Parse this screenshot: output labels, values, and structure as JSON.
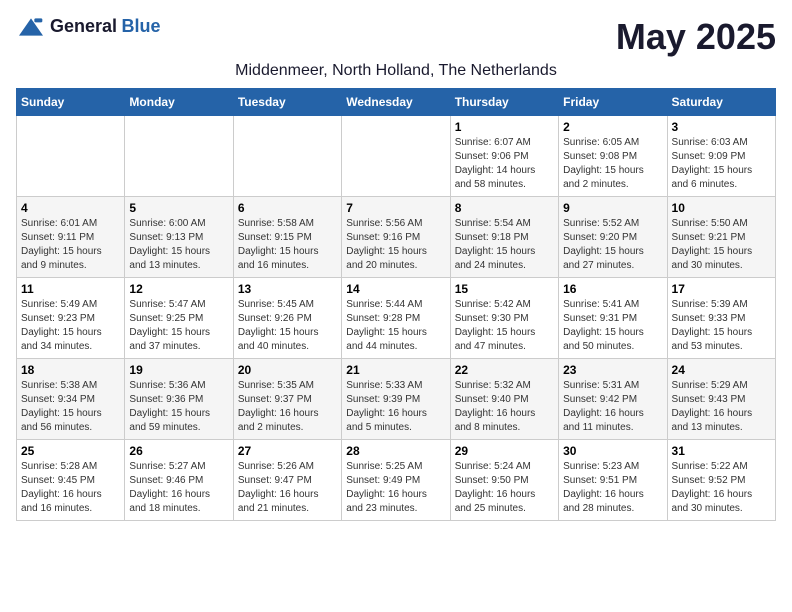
{
  "logo": {
    "general": "General",
    "blue": "Blue"
  },
  "title": "May 2025",
  "subtitle": "Middenmeer, North Holland, The Netherlands",
  "days_of_week": [
    "Sunday",
    "Monday",
    "Tuesday",
    "Wednesday",
    "Thursday",
    "Friday",
    "Saturday"
  ],
  "weeks": [
    [
      {
        "day": "",
        "detail": ""
      },
      {
        "day": "",
        "detail": ""
      },
      {
        "day": "",
        "detail": ""
      },
      {
        "day": "",
        "detail": ""
      },
      {
        "day": "1",
        "detail": "Sunrise: 6:07 AM\nSunset: 9:06 PM\nDaylight: 14 hours\nand 58 minutes."
      },
      {
        "day": "2",
        "detail": "Sunrise: 6:05 AM\nSunset: 9:08 PM\nDaylight: 15 hours\nand 2 minutes."
      },
      {
        "day": "3",
        "detail": "Sunrise: 6:03 AM\nSunset: 9:09 PM\nDaylight: 15 hours\nand 6 minutes."
      }
    ],
    [
      {
        "day": "4",
        "detail": "Sunrise: 6:01 AM\nSunset: 9:11 PM\nDaylight: 15 hours\nand 9 minutes."
      },
      {
        "day": "5",
        "detail": "Sunrise: 6:00 AM\nSunset: 9:13 PM\nDaylight: 15 hours\nand 13 minutes."
      },
      {
        "day": "6",
        "detail": "Sunrise: 5:58 AM\nSunset: 9:15 PM\nDaylight: 15 hours\nand 16 minutes."
      },
      {
        "day": "7",
        "detail": "Sunrise: 5:56 AM\nSunset: 9:16 PM\nDaylight: 15 hours\nand 20 minutes."
      },
      {
        "day": "8",
        "detail": "Sunrise: 5:54 AM\nSunset: 9:18 PM\nDaylight: 15 hours\nand 24 minutes."
      },
      {
        "day": "9",
        "detail": "Sunrise: 5:52 AM\nSunset: 9:20 PM\nDaylight: 15 hours\nand 27 minutes."
      },
      {
        "day": "10",
        "detail": "Sunrise: 5:50 AM\nSunset: 9:21 PM\nDaylight: 15 hours\nand 30 minutes."
      }
    ],
    [
      {
        "day": "11",
        "detail": "Sunrise: 5:49 AM\nSunset: 9:23 PM\nDaylight: 15 hours\nand 34 minutes."
      },
      {
        "day": "12",
        "detail": "Sunrise: 5:47 AM\nSunset: 9:25 PM\nDaylight: 15 hours\nand 37 minutes."
      },
      {
        "day": "13",
        "detail": "Sunrise: 5:45 AM\nSunset: 9:26 PM\nDaylight: 15 hours\nand 40 minutes."
      },
      {
        "day": "14",
        "detail": "Sunrise: 5:44 AM\nSunset: 9:28 PM\nDaylight: 15 hours\nand 44 minutes."
      },
      {
        "day": "15",
        "detail": "Sunrise: 5:42 AM\nSunset: 9:30 PM\nDaylight: 15 hours\nand 47 minutes."
      },
      {
        "day": "16",
        "detail": "Sunrise: 5:41 AM\nSunset: 9:31 PM\nDaylight: 15 hours\nand 50 minutes."
      },
      {
        "day": "17",
        "detail": "Sunrise: 5:39 AM\nSunset: 9:33 PM\nDaylight: 15 hours\nand 53 minutes."
      }
    ],
    [
      {
        "day": "18",
        "detail": "Sunrise: 5:38 AM\nSunset: 9:34 PM\nDaylight: 15 hours\nand 56 minutes."
      },
      {
        "day": "19",
        "detail": "Sunrise: 5:36 AM\nSunset: 9:36 PM\nDaylight: 15 hours\nand 59 minutes."
      },
      {
        "day": "20",
        "detail": "Sunrise: 5:35 AM\nSunset: 9:37 PM\nDaylight: 16 hours\nand 2 minutes."
      },
      {
        "day": "21",
        "detail": "Sunrise: 5:33 AM\nSunset: 9:39 PM\nDaylight: 16 hours\nand 5 minutes."
      },
      {
        "day": "22",
        "detail": "Sunrise: 5:32 AM\nSunset: 9:40 PM\nDaylight: 16 hours\nand 8 minutes."
      },
      {
        "day": "23",
        "detail": "Sunrise: 5:31 AM\nSunset: 9:42 PM\nDaylight: 16 hours\nand 11 minutes."
      },
      {
        "day": "24",
        "detail": "Sunrise: 5:29 AM\nSunset: 9:43 PM\nDaylight: 16 hours\nand 13 minutes."
      }
    ],
    [
      {
        "day": "25",
        "detail": "Sunrise: 5:28 AM\nSunset: 9:45 PM\nDaylight: 16 hours\nand 16 minutes."
      },
      {
        "day": "26",
        "detail": "Sunrise: 5:27 AM\nSunset: 9:46 PM\nDaylight: 16 hours\nand 18 minutes."
      },
      {
        "day": "27",
        "detail": "Sunrise: 5:26 AM\nSunset: 9:47 PM\nDaylight: 16 hours\nand 21 minutes."
      },
      {
        "day": "28",
        "detail": "Sunrise: 5:25 AM\nSunset: 9:49 PM\nDaylight: 16 hours\nand 23 minutes."
      },
      {
        "day": "29",
        "detail": "Sunrise: 5:24 AM\nSunset: 9:50 PM\nDaylight: 16 hours\nand 25 minutes."
      },
      {
        "day": "30",
        "detail": "Sunrise: 5:23 AM\nSunset: 9:51 PM\nDaylight: 16 hours\nand 28 minutes."
      },
      {
        "day": "31",
        "detail": "Sunrise: 5:22 AM\nSunset: 9:52 PM\nDaylight: 16 hours\nand 30 minutes."
      }
    ]
  ]
}
